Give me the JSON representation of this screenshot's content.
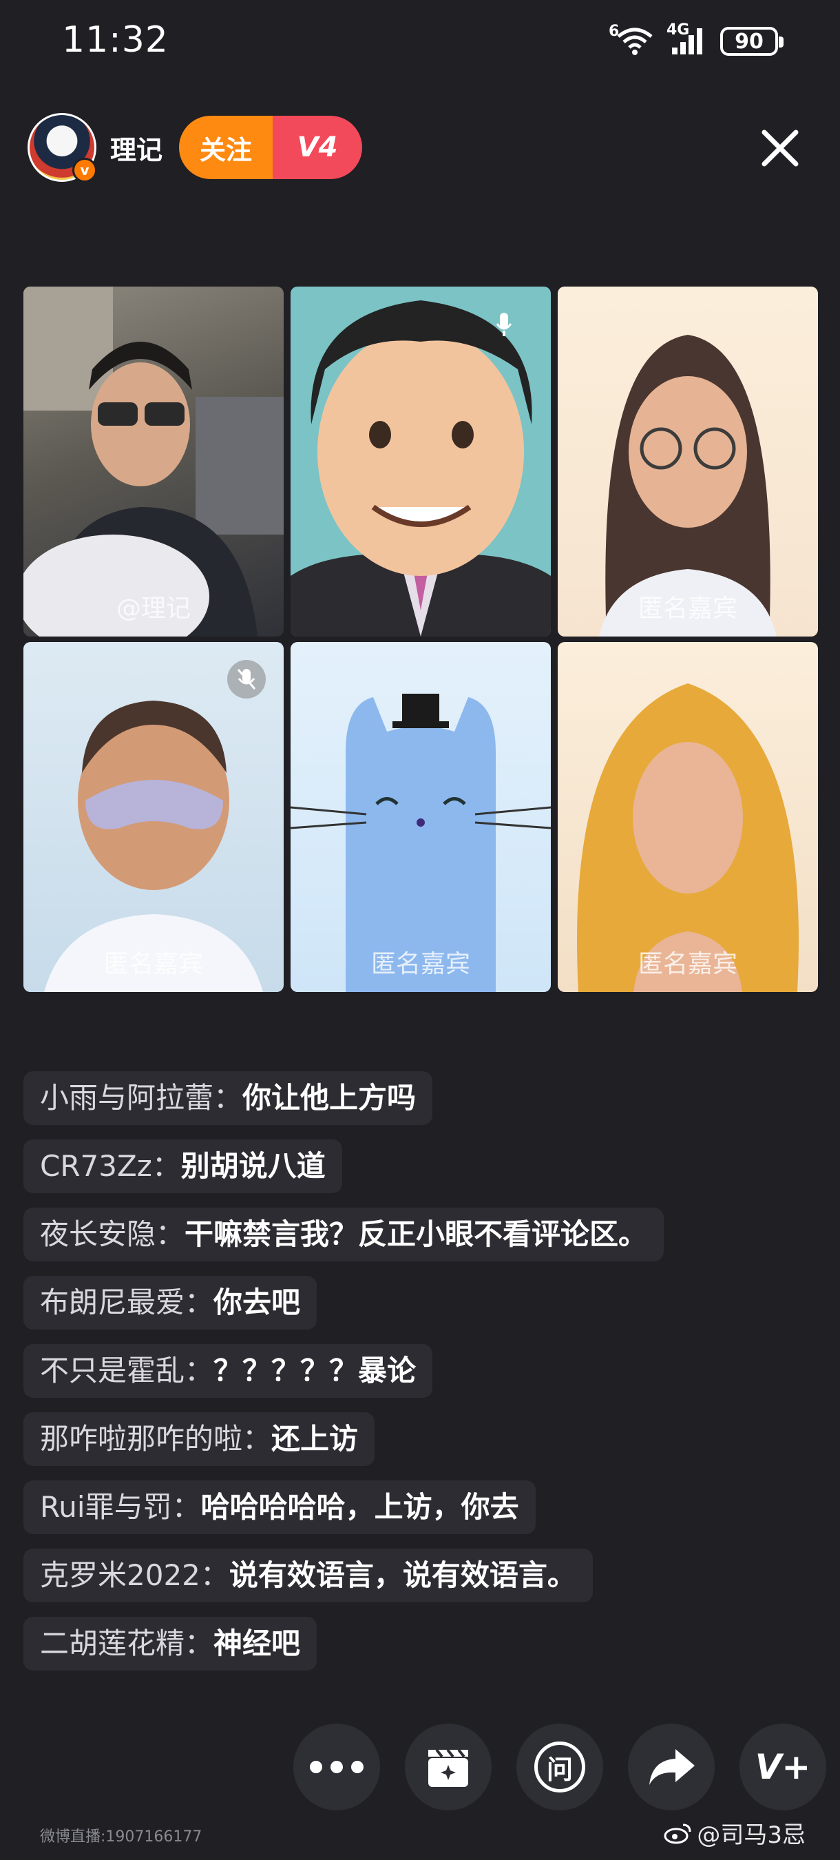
{
  "status_bar": {
    "time": "11:32",
    "wifi_label": "6",
    "network_label": "4G",
    "battery": "90"
  },
  "header": {
    "host_name": "理记",
    "verified_badge": "v",
    "follow_label": "关注",
    "level_label": "V4",
    "close_icon": "close-icon"
  },
  "guests": [
    {
      "label": "@理记",
      "icon": "camera-feed"
    },
    {
      "label": "",
      "icon": "mic-icon"
    },
    {
      "label": "匿名嘉宾",
      "icon": "avatar-glasses-woman"
    },
    {
      "label": "匿名嘉宾",
      "icon": "mic-muted-icon"
    },
    {
      "label": "匿名嘉宾",
      "icon": "cat-avatar"
    },
    {
      "label": "匿名嘉宾",
      "icon": "avatar-blonde-woman"
    }
  ],
  "comments": [
    {
      "user": "小雨与阿拉蕾：",
      "text": "你让他上方吗"
    },
    {
      "user": "CR73Zz：",
      "text": "别胡说八道"
    },
    {
      "user": "夜长安隐：",
      "text": "干嘛禁言我？反正小眼不看评论区。"
    },
    {
      "user": "布朗尼最爱：",
      "text": "你去吧"
    },
    {
      "user": "不只是霍乱：",
      "text": "？？？？？暴论"
    },
    {
      "user": "那咋啦那咋的啦：",
      "text": "还上访"
    },
    {
      "user": "Rui罪与罚：",
      "text": "哈哈哈哈哈，上访，你去"
    },
    {
      "user": "克罗米2022：",
      "text": "说有效语言，说有效语言。"
    },
    {
      "user": "二胡莲花精：",
      "text": "神经吧"
    }
  ],
  "toolbar": {
    "items": [
      "more-icon",
      "clapper-icon",
      "ask-icon",
      "share-icon",
      "v-plus-icon"
    ],
    "ask_label": "问",
    "v_label": "V+"
  },
  "footer": {
    "live_id": "微博直播:1907166177",
    "watermark": "@司马3忌"
  },
  "colors": {
    "background": "#1f1f24",
    "follow": "#ff8a12",
    "level": "#f24a5a"
  }
}
